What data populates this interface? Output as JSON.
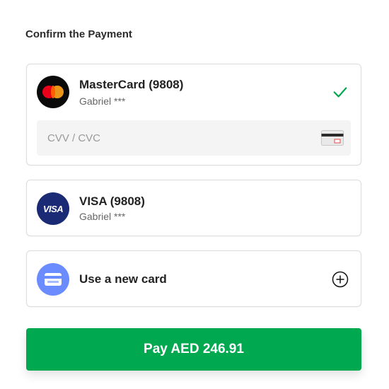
{
  "header": {
    "title": "Confirm the Payment"
  },
  "cards": [
    {
      "brand_icon": "mastercard-logo-icon",
      "name": "MasterCard (9808)",
      "holder": "Gabriel ***",
      "selected": true,
      "selected_icon": "check-icon",
      "cvv_placeholder": "CVV / CVC",
      "cvv_value": "",
      "cvv_icon": "card-back-cvv-icon"
    },
    {
      "brand_icon": "visa-logo-icon",
      "brand_text": "VISA",
      "name": "VISA (9808)",
      "holder": "Gabriel ***",
      "selected": false
    }
  ],
  "new_card": {
    "icon": "credit-card-icon",
    "label": "Use a new card",
    "action_icon": "plus-circle-icon"
  },
  "pay_button": {
    "label": "Pay AED 246.91"
  },
  "colors": {
    "accent_green": "#00a84f",
    "check_green": "#00a84f",
    "visa_blue": "#1a2a74",
    "new_card_blue": "#6a8cff",
    "mc_red": "#eb001b",
    "mc_yellow": "#f79e1b"
  }
}
